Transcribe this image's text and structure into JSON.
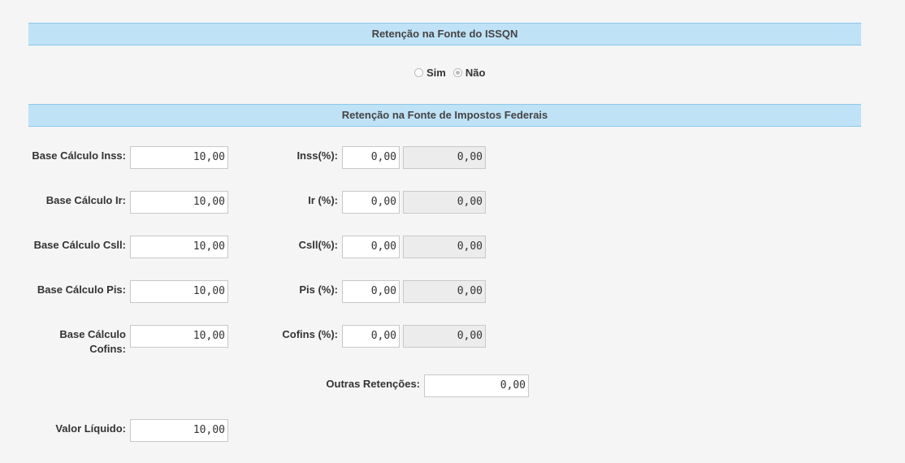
{
  "iss_section": {
    "title": "Retenção na Fonte do ISSQN",
    "options": [
      {
        "label": "Sim",
        "checked": false
      },
      {
        "label": "Não",
        "checked": true
      }
    ]
  },
  "federal_section": {
    "title": "Retenção na Fonte de Impostos Federais"
  },
  "rows": [
    {
      "base_label": "Base Cálculo Inss:",
      "base_value": "10,00",
      "pct_label": "Inss(%):",
      "pct_value": "0,00",
      "amount_value": "0,00"
    },
    {
      "base_label": "Base Cálculo Ir:",
      "base_value": "10,00",
      "pct_label": "Ir (%):",
      "pct_value": "0,00",
      "amount_value": "0,00"
    },
    {
      "base_label": "Base Cálculo Csll:",
      "base_value": "10,00",
      "pct_label": "Csll(%):",
      "pct_value": "0,00",
      "amount_value": "0,00"
    },
    {
      "base_label": "Base Cálculo Pis:",
      "base_value": "10,00",
      "pct_label": "Pis (%):",
      "pct_value": "0,00",
      "amount_value": "0,00"
    },
    {
      "base_label_line1": "Base Cálculo",
      "base_label_line2": "Cofins:",
      "base_value": "10,00",
      "pct_label": "Cofins (%):",
      "pct_value": "0,00",
      "amount_value": "0,00"
    }
  ],
  "outras": {
    "label": "Outras Retenções:",
    "value": "0,00"
  },
  "liquido": {
    "label": "Valor Líquido:",
    "value": "10,00"
  }
}
